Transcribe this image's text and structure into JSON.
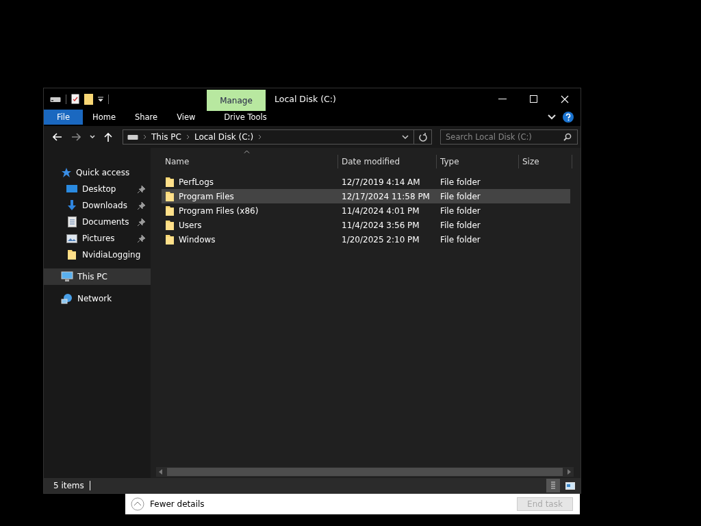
{
  "window": {
    "title": "Local Disk (C:)",
    "contextual_tab": "Manage"
  },
  "ribbon_tabs": [
    {
      "label": "File",
      "kind": "file"
    },
    {
      "label": "Home",
      "kind": "tab"
    },
    {
      "label": "Share",
      "kind": "tab"
    },
    {
      "label": "View",
      "kind": "tab"
    },
    {
      "label": "Drive Tools",
      "kind": "context"
    }
  ],
  "address_bar": {
    "breadcrumbs": [
      "This PC",
      "Local Disk (C:)"
    ]
  },
  "search": {
    "placeholder": "Search Local Disk (C:)"
  },
  "sidebar": {
    "items": [
      {
        "label": "Quick access",
        "kind": "star",
        "selected": false,
        "children": [
          {
            "label": "Desktop",
            "kind": "desktop",
            "pinned": true,
            "selected": false
          },
          {
            "label": "Downloads",
            "kind": "download",
            "pinned": true,
            "selected": false
          },
          {
            "label": "Documents",
            "kind": "document",
            "pinned": true,
            "selected": false
          },
          {
            "label": "Pictures",
            "kind": "pictures",
            "pinned": true,
            "selected": false
          },
          {
            "label": "NvidiaLogging",
            "kind": "folder",
            "pinned": false,
            "selected": false
          }
        ]
      },
      {
        "label": "This PC",
        "kind": "pc",
        "selected": true
      },
      {
        "label": "Network",
        "kind": "network",
        "selected": false
      }
    ]
  },
  "table": {
    "columns": [
      "Name",
      "Date modified",
      "Type",
      "Size"
    ],
    "rows": [
      {
        "name": "PerfLogs",
        "date_modified": "12/7/2019 4:14 AM",
        "type": "File folder",
        "selected": false
      },
      {
        "name": "Program Files",
        "date_modified": "12/17/2024 11:58 PM",
        "type": "File folder",
        "selected": true
      },
      {
        "name": "Program Files (x86)",
        "date_modified": "11/4/2024 4:01 PM",
        "type": "File folder",
        "selected": false
      },
      {
        "name": "Users",
        "date_modified": "11/4/2024 3:56 PM",
        "type": "File folder",
        "selected": false
      },
      {
        "name": "Windows",
        "date_modified": "1/20/2025 2:10 PM",
        "type": "File folder",
        "selected": false
      }
    ]
  },
  "status_bar": {
    "item_count": "5 items"
  },
  "background_window": {
    "details_toggle": "Fewer details",
    "end_task": {
      "label": "End task",
      "disabled": true
    }
  }
}
